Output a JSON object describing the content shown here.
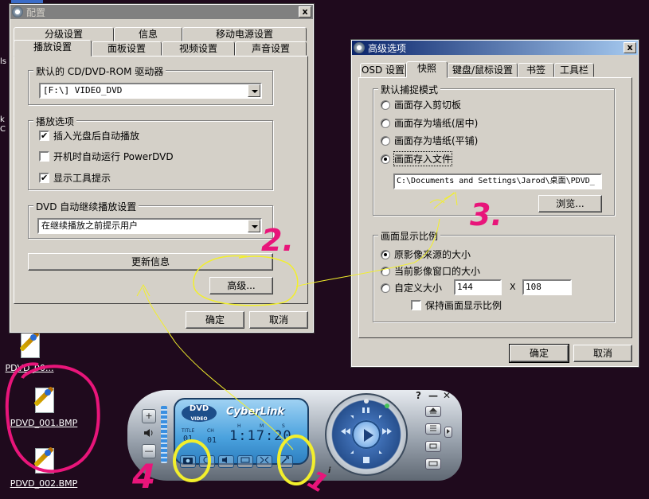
{
  "colors": {
    "desktop": "#1f0a1d",
    "annotation_pink": "#e8157a",
    "annotation_yellow": "#f2ef2c",
    "dialog_face": "#d4d0c8",
    "active_title": "#0a246a",
    "inactive_title": "#808080"
  },
  "desktop": {
    "icons": [
      {
        "label": "PDVD_00..."
      },
      {
        "label": "PDVD_001.BMP"
      },
      {
        "label": "PDVD_002.BMP"
      }
    ],
    "edge_fragments": [
      "ls",
      "k",
      "C"
    ]
  },
  "config_dialog": {
    "title": "配置",
    "close": "x",
    "tabs_back": [
      "分级设置",
      "信息",
      "移动电源设置"
    ],
    "tabs_front": [
      "播放设置",
      "面板设置",
      "视频设置",
      "声音设置"
    ],
    "drive_group": {
      "label": "默认的 CD/DVD-ROM 驱动器",
      "value": "[F:\\] VIDEO_DVD"
    },
    "play_group": {
      "label": "播放选项",
      "options": [
        {
          "label": "插入光盘后自动播放",
          "checked": true,
          "mark": "✔"
        },
        {
          "label": "开机时自动运行 PowerDVD",
          "checked": false,
          "mark": ""
        },
        {
          "label": "显示工具提示",
          "checked": true,
          "mark": "✔"
        }
      ]
    },
    "resume_group": {
      "label": "DVD 自动继续播放设置",
      "value": "在继续播放之前提示用户"
    },
    "update_button": "更新信息",
    "advanced_button": "高级...",
    "ok": "确定",
    "cancel": "取消"
  },
  "advanced_dialog": {
    "title": "高级选项",
    "close": "x",
    "tabs": [
      "OSD 设置",
      "快照",
      "键盘/鼠标设置",
      "书签",
      "工具栏"
    ],
    "capture_group": {
      "label": "默认捕捉模式",
      "options": [
        {
          "label": "画面存入剪切板",
          "selected": false
        },
        {
          "label": "画面存为墙纸(居中)",
          "selected": false
        },
        {
          "label": "画面存为墙纸(平铺)",
          "selected": false
        },
        {
          "label": "画面存入文件",
          "selected": true
        }
      ],
      "path": "C:\\Documents and Settings\\Jarod\\桌面\\PDVD_",
      "browse": "浏览..."
    },
    "ratio_group": {
      "label": "画面显示比例",
      "options": [
        {
          "label": "原影像来源的大小",
          "selected": true
        },
        {
          "label": "当前影像窗口的大小",
          "selected": false
        },
        {
          "label": "自定义大小",
          "selected": false
        }
      ],
      "width": "144",
      "x_sep": "X",
      "height": "108",
      "keep_ratio": "保持画面显示比例"
    },
    "ok": "确定",
    "cancel": "取消"
  },
  "player": {
    "logo_dvd": "DVD",
    "logo_video": "VIDEO",
    "brand": "CyberLink",
    "lcd_labels": {
      "title": "TITLE",
      "ch": "CH",
      "h": "H",
      "m": "M",
      "s": "S"
    },
    "title_num": "01",
    "chapter_num": "01",
    "time": "1:17:20",
    "help": "?",
    "minimize": "—",
    "close": "✕",
    "volume_up": "+",
    "volume_down": "—",
    "info": "i"
  },
  "annotations": [
    "1",
    "2.",
    "3.",
    "4"
  ]
}
